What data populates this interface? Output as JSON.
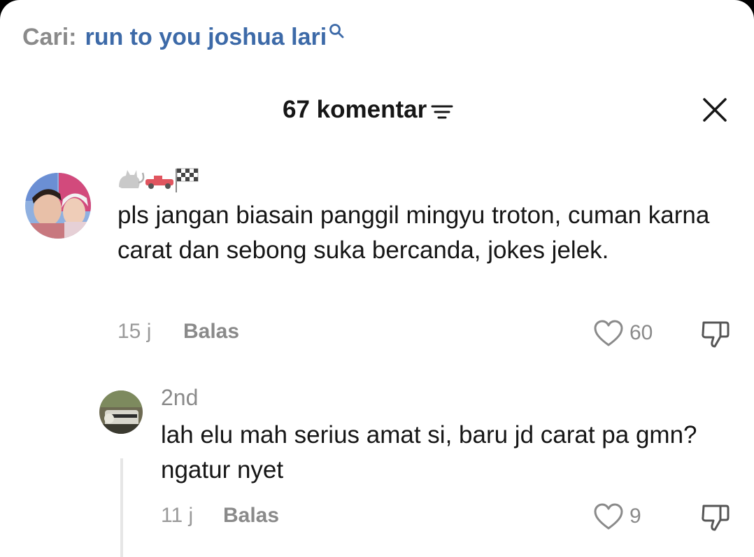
{
  "search": {
    "prefix": "Cari:",
    "query": "run to you joshua lari"
  },
  "header": {
    "comment_count": "67 komentar"
  },
  "comments": [
    {
      "username_emoji": [
        "cat",
        "race-car",
        "checkered-flag"
      ],
      "text": "pls jangan biasain panggil mingyu troton, cuman karna carat dan sebong suka bercanda, jokes jelek.",
      "time": "15 j",
      "reply_label": "Balas",
      "likes": "60"
    }
  ],
  "replies": [
    {
      "username": "2nd",
      "text": "lah elu mah serius amat si, baru jd carat pa gmn? ngatur nyet",
      "time": "11 j",
      "reply_label": "Balas",
      "likes": "9"
    }
  ],
  "colors": {
    "query": "#3d6aa8",
    "muted": "#8a8a8a",
    "text": "#161616",
    "background": "#ffffff"
  },
  "icons": [
    "search-icon",
    "filter-icon",
    "close-icon",
    "heart-icon",
    "dislike-icon"
  ]
}
